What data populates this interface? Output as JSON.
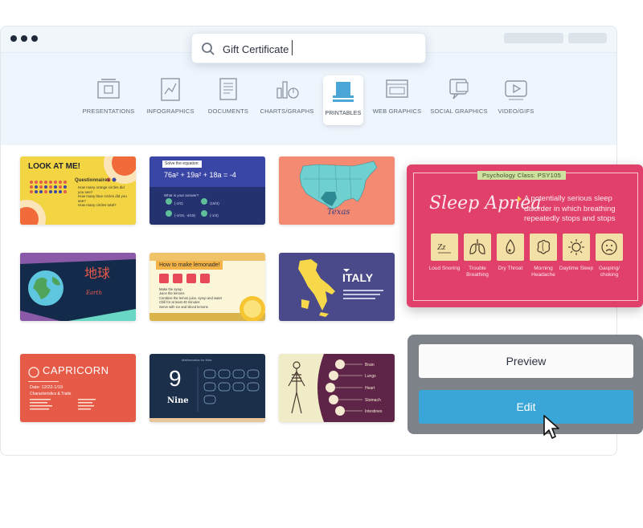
{
  "search": {
    "value": "Gift Certificate"
  },
  "categories": [
    {
      "label": "PRESENTATIONS"
    },
    {
      "label": "INFOGRAPHICS"
    },
    {
      "label": "DOCUMENTS"
    },
    {
      "label": "CHARTS/GRAPHS"
    },
    {
      "label": "PRINTABLES"
    },
    {
      "label": "WEB GRAPHICS"
    },
    {
      "label": "SOCIAL GRAPHICS"
    },
    {
      "label": "VIDEO/GIFS"
    }
  ],
  "active_category": "PRINTABLES",
  "templates": {
    "t1": {
      "heading": "LOOK AT ME!",
      "sub": "Questionnaires",
      "bullets": [
        "How many orange circles did you see?",
        "How many blue circles did you see?",
        "How many circles total?"
      ]
    },
    "t2": {
      "tag": "Solve the equation:",
      "equation": "76a² + 19a² + 18a = -4",
      "question": "What is your answer?",
      "opt_a": "(-2/2)",
      "opt_b": "(-4/19, -4/19)",
      "opt_c": "(19/4)",
      "opt_d": "(-1/4)"
    },
    "t3": {
      "caption": "Texas"
    },
    "t4": {
      "title": "地球",
      "subtitle": "Earth"
    },
    "t5": {
      "heading": "How to make lemonade!",
      "steps": [
        "Make the syrup",
        "Juice the lemons",
        "Combine the lemon juice, syrup and water",
        "Chill for at least 40 minutes",
        "Serve with ice and sliced lemons"
      ]
    },
    "t6": {
      "title": "ITALY"
    },
    "t7": {
      "title": "CAPRICORN",
      "dates": "Date: 12/22-1/19",
      "sub": "Characteristics & Traits"
    },
    "t8": {
      "big": "9",
      "word": "Nine",
      "header": "Mathematics for Kids"
    },
    "t9": {
      "organs": [
        "Brain",
        "Lungs",
        "Heart",
        "Stomach",
        "Intestines"
      ]
    }
  },
  "featured": {
    "tag": "Psychology Class: PSY105",
    "title": "Sleep Apnea",
    "description": "A potentially serious sleep disorder in which breathing repeatedly stops and stops",
    "symptoms": [
      {
        "label": "Loud Snoring",
        "icon": "zz-icon"
      },
      {
        "label": "Trouble Breathing",
        "icon": "lungs-icon"
      },
      {
        "label": "Dry Throat",
        "icon": "drop-icon"
      },
      {
        "label": "Morning Headache",
        "icon": "brain-icon"
      },
      {
        "label": "Daytime Sleep",
        "icon": "sun-icon"
      },
      {
        "label": "Gasping/ choking",
        "icon": "sad-face-icon"
      }
    ]
  },
  "actions": {
    "preview_label": "Preview",
    "edit_label": "Edit"
  },
  "colors": {
    "edit": "#3aa6d8",
    "featured": "#e0406a",
    "panel": "#7e8389"
  }
}
